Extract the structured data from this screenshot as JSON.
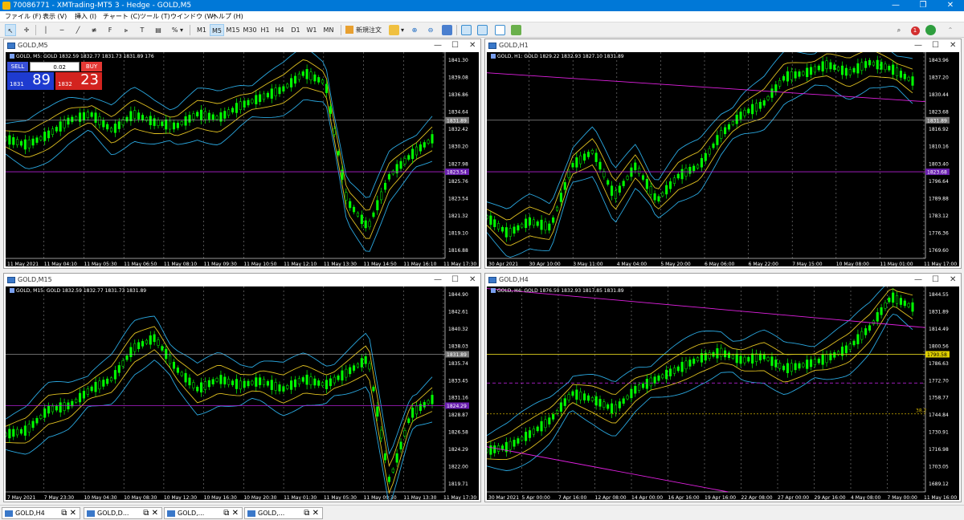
{
  "window": {
    "title": "70086771 - XMTrading-MT5 3 - Hedge - GOLD,M5",
    "minimize": "—",
    "restore": "❐",
    "close": "✕"
  },
  "menu": [
    "ファイル (F)",
    "表示 (V)",
    "挿入 (I)",
    "チャート (C)",
    "ツール (T)",
    "ウインドウ (W)",
    "ヘルプ (H)"
  ],
  "toolbar": {
    "timeframes": [
      "M1",
      "M5",
      "M15",
      "M30",
      "H1",
      "H4",
      "D1",
      "W1",
      "MN"
    ],
    "selected_timeframe": "M5",
    "new_order": "新規注文",
    "notification_count": "1"
  },
  "charts": [
    {
      "title": "GOLD,M5",
      "ohlc": "GOLD, M5:  GOLD  1832.59 1832.77 1831.73 1831.89  176",
      "prices": [
        "1841.30",
        "1839.08",
        "1836.86",
        "1834.64",
        "1832.42",
        "1830.20",
        "1827.98",
        "1825.76",
        "1823.54",
        "1821.32",
        "1819.10",
        "1816.88"
      ],
      "current_price": "1831.89",
      "line_price": "1823.54",
      "times": [
        "11 May 2021",
        "11 May 04:10",
        "11 May 05:30",
        "11 May 06:50",
        "11 May 08:10",
        "11 May 09:30",
        "11 May 10:50",
        "11 May 12:10",
        "11 May 13:30",
        "11 May 14:50",
        "11 May 16:10",
        "11 May 17:30"
      ],
      "trade": {
        "sell": "SELL",
        "buy": "BUY",
        "lot": "0.02",
        "sell_small": "1831",
        "sell_big": "89",
        "buy_small": "1832",
        "buy_big": "23"
      }
    },
    {
      "title": "GOLD,H1",
      "ohlc": "GOLD, H1:  GOLD  1829.22 1832.93 1827.10 1831.89",
      "prices": [
        "1843.96",
        "1837.20",
        "1830.44",
        "1823.68",
        "1816.92",
        "1810.16",
        "1803.40",
        "1796.64",
        "1789.88",
        "1783.12",
        "1776.36",
        "1769.60"
      ],
      "current_price": "1831.89",
      "line_price": "1823.68",
      "times": [
        "30 Apr 2021",
        "30 Apr 10:00",
        "3 May 11:00",
        "4 May 04:00",
        "5 May 20:00",
        "6 May 06:00",
        "6 May 22:00",
        "7 May 15:00",
        "10 May 08:00",
        "11 May 01:00",
        "11 May 17:00"
      ]
    },
    {
      "title": "GOLD,M15",
      "ohlc": "GOLD, M15:  GOLD  1832.59 1832.77 1831.73 1831.89",
      "prices": [
        "1844.90",
        "1842.61",
        "1840.32",
        "1838.03",
        "1835.74",
        "1833.45",
        "1831.16",
        "1828.87",
        "1826.58",
        "1824.29",
        "1822.00",
        "1819.71"
      ],
      "current_price": "1831.89",
      "line_price": "1824.29",
      "times": [
        "7 May 2021",
        "7 May 23:30",
        "10 May 04:30",
        "10 May 08:30",
        "10 May 12:30",
        "10 May 16:30",
        "10 May 20:30",
        "11 May 01:30",
        "11 May 05:30",
        "11 May 09:30",
        "11 May 13:30",
        "11 May 17:30"
      ]
    },
    {
      "title": "GOLD,H4",
      "ohlc": "GOLD, H4:  GOLD  1876.50 1832.93 1817.85 1831.89",
      "prices": [
        "1844.55",
        "1831.89",
        "1814.49",
        "1800.56",
        "1786.63",
        "1772.70",
        "1758.77",
        "1744.84",
        "1730.91",
        "1716.98",
        "1703.05",
        "1689.12"
      ],
      "current_price": "1831.89",
      "yellow_price": "1790.58",
      "magenta_price": "1761.74",
      "fib_label": "38.2",
      "times": [
        "30 Mar 2021",
        "5 Apr 00:00",
        "7 Apr 16:00",
        "12 Apr 08:00",
        "14 Apr 00:00",
        "16 Apr 16:00",
        "19 Apr 16:00",
        "22 Apr 08:00",
        "27 Apr 00:00",
        "29 Apr 16:00",
        "4 May 08:00",
        "7 May 00:00",
        "11 May 16:00"
      ]
    }
  ],
  "tabs": [
    "GOLD,H4",
    "GOLD,D...",
    "GOLD,...",
    "GOLD,..."
  ],
  "colors": {
    "background": "#000000",
    "candle": "#00ff00",
    "band_outer": "#2aa8e0",
    "band_inner": "#e0c020",
    "grid": "#ffffff"
  }
}
